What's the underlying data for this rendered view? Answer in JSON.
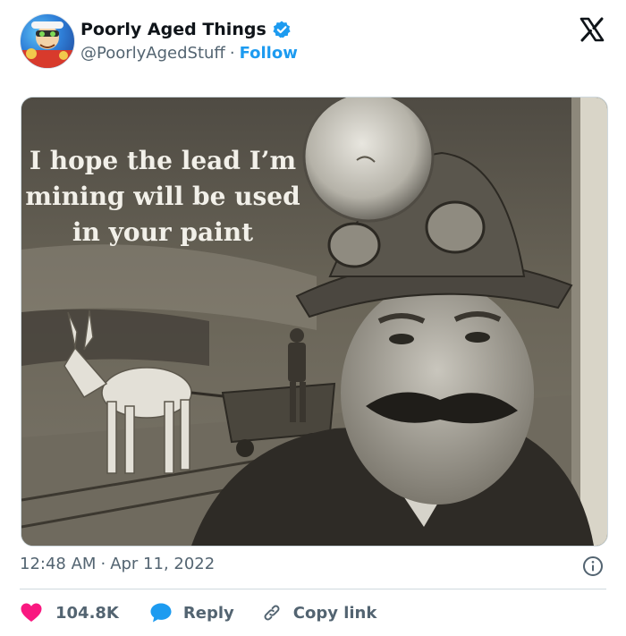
{
  "tweet": {
    "author": {
      "display_name": "Poorly Aged Things",
      "handle": "@PoorlyAgedStuff",
      "separator": "·",
      "follow_label": "Follow",
      "verified": true
    },
    "media": {
      "headline_line1": "I hope the lead I’m",
      "headline_line2": "mining will be used",
      "headline_line3": "in your paint"
    },
    "timestamp": {
      "time": "12:48 AM",
      "separator": "·",
      "date": "Apr 11, 2022"
    },
    "actions": {
      "like_count": "104.8K",
      "reply_label": "Reply",
      "copy_link_label": "Copy link"
    }
  },
  "colors": {
    "accent": "#1d9bf0",
    "like": "#f91880",
    "text": "#0f1419",
    "muted": "#536471",
    "border": "#cfd9de"
  },
  "icons": {
    "verified": "verified-badge-icon",
    "platform": "x-logo-icon",
    "info": "info-icon",
    "like": "heart-icon",
    "reply": "speech-bubble-icon",
    "copy": "link-icon"
  }
}
